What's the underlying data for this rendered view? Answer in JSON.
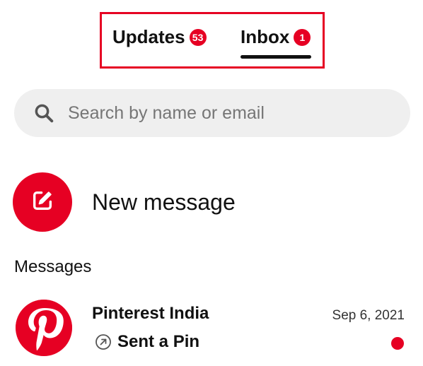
{
  "tabs": {
    "updates": {
      "label": "Updates",
      "badge": "53"
    },
    "inbox": {
      "label": "Inbox",
      "badge": "1",
      "selected": true
    }
  },
  "search": {
    "placeholder": "Search by name or email",
    "value": "",
    "icon": "search-icon"
  },
  "new_message": {
    "label": "New message",
    "icon": "compose-icon"
  },
  "messages_section": {
    "heading": "Messages"
  },
  "conversations": [
    {
      "name": "Pinterest India",
      "preview": "Sent a Pin",
      "preview_icon": "share-arrow-icon",
      "date": "Sep 6, 2021",
      "unread": true,
      "avatar_icon": "pinterest-logo-icon"
    }
  ],
  "colors": {
    "accent": "#e60023",
    "search_bg": "#efefef",
    "text": "#111111",
    "placeholder": "#767676"
  }
}
